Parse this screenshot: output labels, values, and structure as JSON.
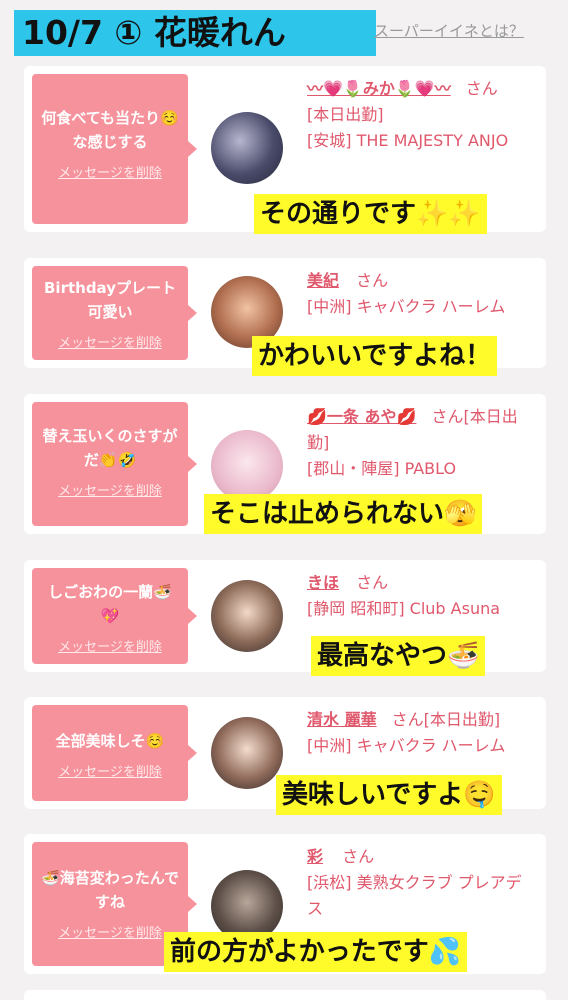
{
  "header": {
    "title": "10/7 ① 花暖れん",
    "super_link": "スーパーイイネとは？"
  },
  "delete_label": "メッセージを削除",
  "cards": [
    {
      "message": "何食べても当たり☺️な感じする",
      "name": "〰💗🌷みか🌷💗〰",
      "san": "さん",
      "line1": "[本日出勤]",
      "line2": "[安城] THE MAJESTY ANJO",
      "caption": "その通りです✨✨"
    },
    {
      "message": "Birthdayプレート可愛い",
      "name": "美紀",
      "san": "さん",
      "line1": "[中洲] キャバクラ ハーレム",
      "line2": "",
      "caption": "かわいいですよね！"
    },
    {
      "message": "替え玉いくのさすがだ👏🤣",
      "name": "💋一条 あや💋",
      "san": "さん[本日出勤]",
      "line1": "[郡山・陣屋] PABLO",
      "line2": "",
      "caption": "そこは止められない🫣"
    },
    {
      "message": "しごおわの一蘭🍜💖",
      "name": "きほ",
      "san": "さん",
      "line1": "[静岡 昭和町] Club Asuna",
      "line2": "",
      "caption": "最高なやつ🍜"
    },
    {
      "message": "全部美味しそ☺️",
      "name": "清水 麗華",
      "san": "さん[本日出勤]",
      "line1": "[中洲] キャバクラ ハーレム",
      "line2": "",
      "caption": "美味しいですよ🤤"
    },
    {
      "message": "🍜海苔変わったんですね",
      "name": "彩",
      "san": "さん",
      "line1": "[浜松] 美熟女クラブ プレアデス",
      "line2": "",
      "caption": "前の方がよかったです💦"
    }
  ],
  "colors": {
    "banner": "#2ec5ea",
    "bubble": "#f6929b",
    "caption": "#fffb2b",
    "text_accent": "#e0586c"
  }
}
